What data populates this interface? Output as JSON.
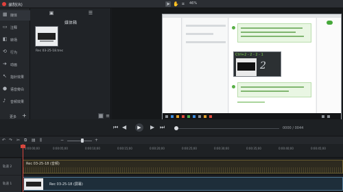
{
  "titlebar": {
    "app_name": "录制(R)",
    "zoom": "46%",
    "tools": [
      "pointer",
      "hand",
      "crop"
    ]
  },
  "lefttools": {
    "items": [
      {
        "label": "媒体",
        "icon": "media-icon",
        "active": true
      },
      {
        "label": "注释",
        "icon": "annotation-icon"
      },
      {
        "label": "转场",
        "icon": "transition-icon"
      },
      {
        "label": "行为",
        "icon": "behavior-icon"
      },
      {
        "label": "动画",
        "icon": "animation-icon"
      },
      {
        "label": "指针效果",
        "icon": "cursor-effect-icon"
      },
      {
        "label": "语音旁白",
        "icon": "microphone-icon"
      },
      {
        "label": "音频效果",
        "icon": "audio-effect-icon"
      }
    ],
    "more_label": "更多"
  },
  "mediabin": {
    "title": "媒体箱",
    "clip_label": "Rec 03-25-18.trec"
  },
  "canvas": {
    "overlay_caption": "Ctrl+2 - 2 - 2 - 1",
    "overlay_digit": "2"
  },
  "playback": {
    "timecode": "0000 / 0044"
  },
  "ruler": {
    "ticks": [
      "0:00:00;00",
      "0:00:05;00",
      "0:00:10;00",
      "0:00:15;00",
      "0:00:20;00",
      "0:00:25;00",
      "0:00:30;00",
      "0:00:35;00",
      "0:00:40;00",
      "0:00:45;00"
    ]
  },
  "tracks": [
    {
      "label": "轨道 2",
      "clip": "Rec 03-25-18 (音频)"
    },
    {
      "label": "轨道 1",
      "clip": "Rec 03-25-18 (屏幕)"
    }
  ]
}
